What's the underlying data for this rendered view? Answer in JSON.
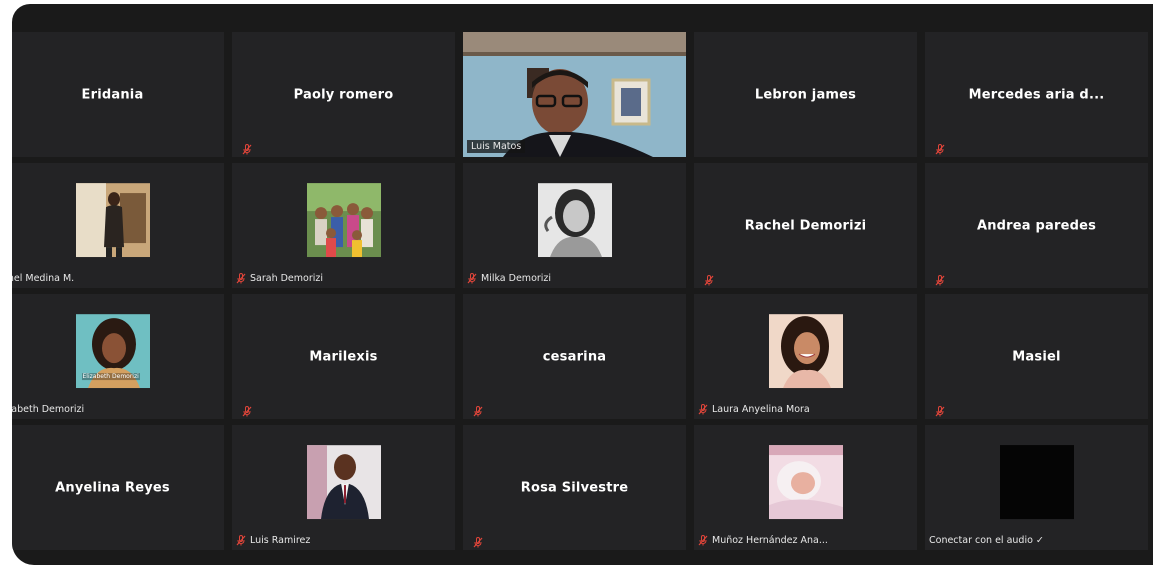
{
  "participants": [
    {
      "name": "Eridania",
      "muted": false
    },
    {
      "name": "Paoly romero",
      "muted": true
    },
    {
      "name": "Luis Matos",
      "muted": false
    },
    {
      "name": "Lebron james",
      "muted": false
    },
    {
      "name": "Mercedes aria d...",
      "muted": true
    },
    {
      "name": "Rainel Medina M.",
      "muted": false
    },
    {
      "name": "Sarah Demorizi",
      "muted": true
    },
    {
      "name": "Milka Demorizi",
      "muted": true
    },
    {
      "name": "Rachel Demorizi",
      "muted": true
    },
    {
      "name": "Andrea paredes",
      "muted": true
    },
    {
      "name": "Elizabeth Demorizi",
      "muted": false,
      "photo_text": "Elizabeth Demorizi"
    },
    {
      "name": "Marilexis",
      "muted": true
    },
    {
      "name": "cesarina",
      "muted": true
    },
    {
      "name": "Laura Anyelina Mora",
      "muted": true
    },
    {
      "name": "Masiel",
      "muted": true
    },
    {
      "name": "Anyelina Reyes",
      "muted": false
    },
    {
      "name": "Luis Ramirez",
      "muted": true
    },
    {
      "name": "Rosa Silvestre",
      "muted": true
    },
    {
      "name": "Muñoz Hernández Ana...",
      "muted": true
    },
    {
      "name": "Conectar con el audio ✓",
      "muted": false
    }
  ],
  "colors": {
    "background": "#1a1a1a",
    "tile": "#232325",
    "active_speaker_border": "#b8d97a",
    "muted_icon": "#e0453a"
  }
}
